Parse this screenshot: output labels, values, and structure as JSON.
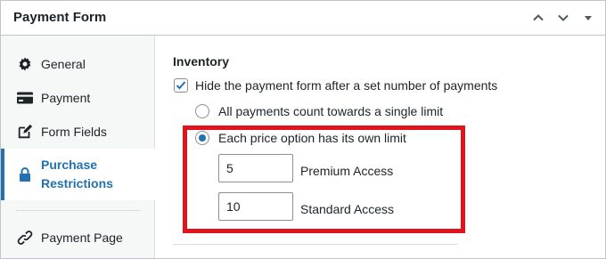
{
  "panel": {
    "title": "Payment Form",
    "header_icons": [
      "chevron-up-icon",
      "chevron-down-icon",
      "caret-down-icon"
    ]
  },
  "sidebar": {
    "items": [
      {
        "label": "General",
        "icon": "gear-icon",
        "active": false
      },
      {
        "label": "Payment",
        "icon": "credit-card-icon",
        "active": false
      },
      {
        "label": "Form Fields",
        "icon": "edit-icon",
        "active": false
      },
      {
        "label": "Purchase Restrictions",
        "label_line1": "Purchase",
        "label_line2": "Restrictions",
        "icon": "lock-icon",
        "active": true
      },
      {
        "label": "Payment Page",
        "icon": "link-icon",
        "active": false
      }
    ]
  },
  "inventory": {
    "section_title": "Inventory",
    "hide_form_label": "Hide the payment form after a set number of payments",
    "hide_form_checked": true,
    "options": [
      {
        "label": "All payments count towards a single limit",
        "selected": false
      },
      {
        "label": "Each price option has its own limit",
        "selected": true
      }
    ],
    "limits": [
      {
        "value": "5",
        "label": "Premium Access"
      },
      {
        "value": "10",
        "label": "Standard Access"
      }
    ]
  },
  "colors": {
    "accent": "#2271b1",
    "highlight": "#e0141e"
  }
}
